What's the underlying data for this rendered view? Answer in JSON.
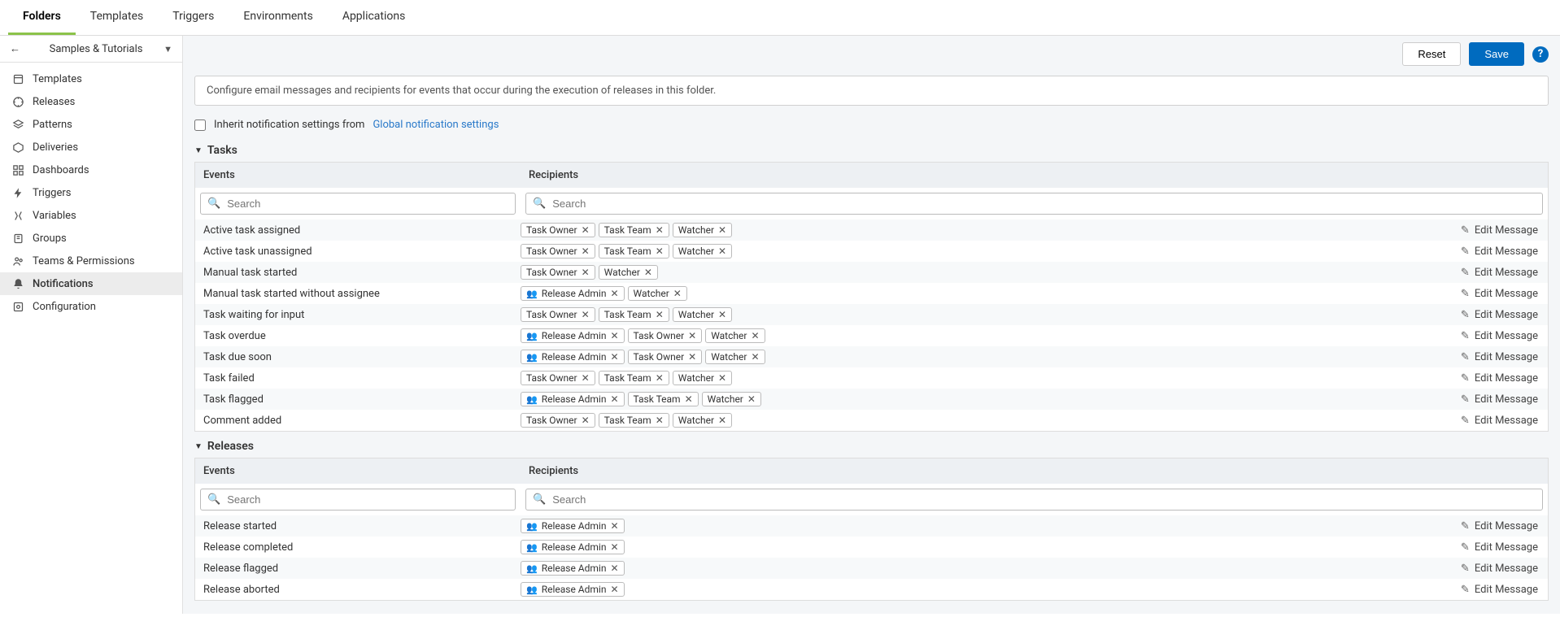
{
  "tabs": [
    "Folders",
    "Templates",
    "Triggers",
    "Environments",
    "Applications"
  ],
  "active_tab": 0,
  "breadcrumb": {
    "title": "Samples & Tutorials"
  },
  "sidebar": [
    {
      "icon": "template",
      "label": "Templates"
    },
    {
      "icon": "releases",
      "label": "Releases"
    },
    {
      "icon": "patterns",
      "label": "Patterns"
    },
    {
      "icon": "deliveries",
      "label": "Deliveries"
    },
    {
      "icon": "dashboards",
      "label": "Dashboards"
    },
    {
      "icon": "triggers",
      "label": "Triggers"
    },
    {
      "icon": "variables",
      "label": "Variables"
    },
    {
      "icon": "groups",
      "label": "Groups"
    },
    {
      "icon": "teams",
      "label": "Teams & Permissions"
    },
    {
      "icon": "notifications",
      "label": "Notifications"
    },
    {
      "icon": "configuration",
      "label": "Configuration"
    }
  ],
  "active_sidebar": 9,
  "buttons": {
    "reset": "Reset",
    "save": "Save"
  },
  "info": "Configure email messages and recipients for events that occur during the execution of releases in this folder.",
  "inherit": {
    "label": "Inherit notification settings from",
    "link": "Global notification settings",
    "checked": false
  },
  "search_placeholder": "Search",
  "edit_label": "Edit Message",
  "columns": {
    "events": "Events",
    "recipients": "Recipients"
  },
  "sections": [
    {
      "title": "Tasks",
      "rows": [
        {
          "event": "Active task assigned",
          "recipients": [
            {
              "label": "Task Owner"
            },
            {
              "label": "Task Team"
            },
            {
              "label": "Watcher"
            }
          ]
        },
        {
          "event": "Active task unassigned",
          "recipients": [
            {
              "label": "Task Owner"
            },
            {
              "label": "Task Team"
            },
            {
              "label": "Watcher"
            }
          ]
        },
        {
          "event": "Manual task started",
          "recipients": [
            {
              "label": "Task Owner"
            },
            {
              "label": "Watcher"
            }
          ]
        },
        {
          "event": "Manual task started without assignee",
          "recipients": [
            {
              "label": "Release Admin",
              "person": true
            },
            {
              "label": "Watcher"
            }
          ]
        },
        {
          "event": "Task waiting for input",
          "recipients": [
            {
              "label": "Task Owner"
            },
            {
              "label": "Task Team"
            },
            {
              "label": "Watcher"
            }
          ]
        },
        {
          "event": "Task overdue",
          "recipients": [
            {
              "label": "Release Admin",
              "person": true
            },
            {
              "label": "Task Owner"
            },
            {
              "label": "Watcher"
            }
          ]
        },
        {
          "event": "Task due soon",
          "recipients": [
            {
              "label": "Release Admin",
              "person": true
            },
            {
              "label": "Task Owner"
            },
            {
              "label": "Watcher"
            }
          ]
        },
        {
          "event": "Task failed",
          "recipients": [
            {
              "label": "Task Owner"
            },
            {
              "label": "Task Team"
            },
            {
              "label": "Watcher"
            }
          ]
        },
        {
          "event": "Task flagged",
          "recipients": [
            {
              "label": "Release Admin",
              "person": true
            },
            {
              "label": "Task Team"
            },
            {
              "label": "Watcher"
            }
          ]
        },
        {
          "event": "Comment added",
          "recipients": [
            {
              "label": "Task Owner"
            },
            {
              "label": "Task Team"
            },
            {
              "label": "Watcher"
            }
          ]
        }
      ]
    },
    {
      "title": "Releases",
      "rows": [
        {
          "event": "Release started",
          "recipients": [
            {
              "label": "Release Admin",
              "person": true
            }
          ]
        },
        {
          "event": "Release completed",
          "recipients": [
            {
              "label": "Release Admin",
              "person": true
            }
          ]
        },
        {
          "event": "Release flagged",
          "recipients": [
            {
              "label": "Release Admin",
              "person": true
            }
          ]
        },
        {
          "event": "Release aborted",
          "recipients": [
            {
              "label": "Release Admin",
              "person": true
            }
          ]
        }
      ]
    }
  ]
}
